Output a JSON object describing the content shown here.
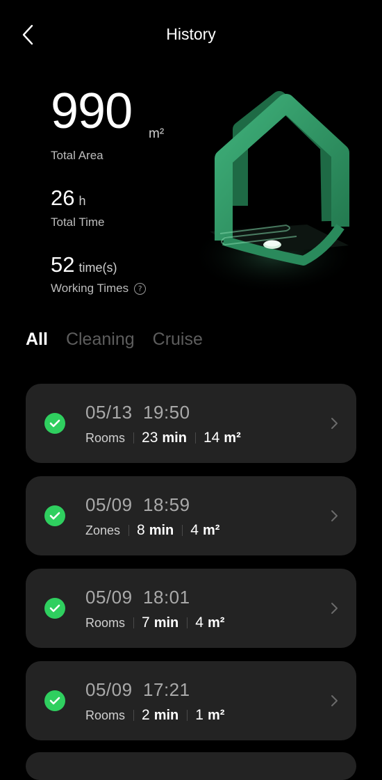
{
  "header": {
    "title": "History",
    "back_icon": "chevron-left-icon"
  },
  "stats": {
    "total_area": {
      "value": "990",
      "unit": "m²",
      "label": "Total Area"
    },
    "total_time": {
      "value": "26",
      "unit": "h",
      "label": "Total Time"
    },
    "working_times": {
      "value": "52",
      "unit": "time(s)",
      "label": "Working Times",
      "help_icon": "?"
    }
  },
  "illustration": {
    "name": "house-illustration",
    "color": "#2f9a64"
  },
  "tabs": [
    {
      "label": "All",
      "active": true
    },
    {
      "label": "Cleaning",
      "active": false
    },
    {
      "label": "Cruise",
      "active": false
    }
  ],
  "records": [
    {
      "date": "05/13",
      "time": "19:50",
      "mode": "Rooms",
      "duration": "23",
      "duration_unit": "min",
      "area": "14",
      "area_unit": "m²"
    },
    {
      "date": "05/09",
      "time": "18:59",
      "mode": "Zones",
      "duration": "8",
      "duration_unit": "min",
      "area": "4",
      "area_unit": "m²"
    },
    {
      "date": "05/09",
      "time": "18:01",
      "mode": "Rooms",
      "duration": "7",
      "duration_unit": "min",
      "area": "4",
      "area_unit": "m²"
    },
    {
      "date": "05/09",
      "time": "17:21",
      "mode": "Rooms",
      "duration": "2",
      "duration_unit": "min",
      "area": "1",
      "area_unit": "m²"
    }
  ],
  "colors": {
    "background": "#000000",
    "card": "#232323",
    "success": "#2fcf5f",
    "tab_inactive": "#5d5d5d"
  }
}
